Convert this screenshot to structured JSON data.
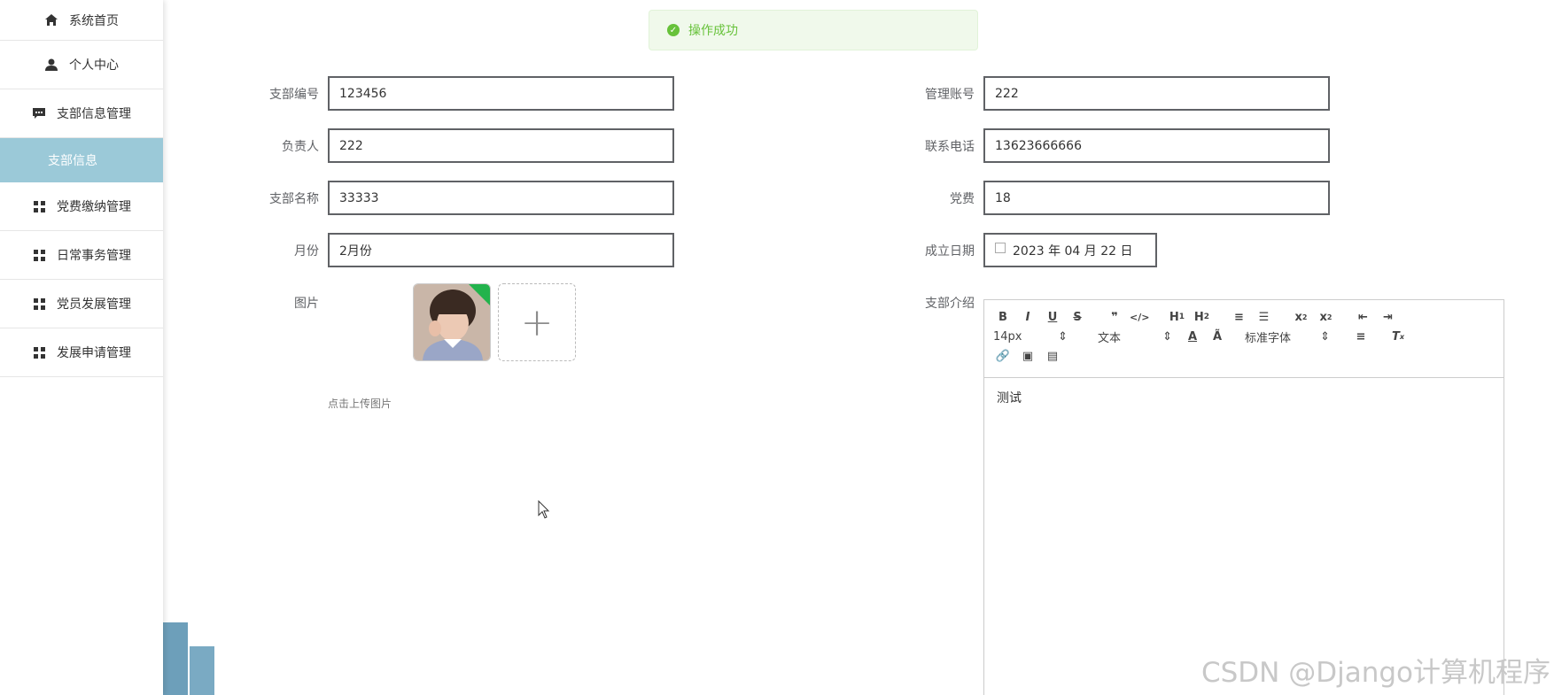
{
  "sidebar": {
    "items": [
      {
        "label": "系统首页",
        "icon": "home-icon"
      },
      {
        "label": "个人中心",
        "icon": "user-icon"
      },
      {
        "label": "支部信息管理",
        "icon": "message-icon"
      },
      {
        "label": "支部信息",
        "icon": "",
        "active": true
      },
      {
        "label": "党费缴纳管理",
        "icon": "grid-icon"
      },
      {
        "label": "日常事务管理",
        "icon": "grid-icon"
      },
      {
        "label": "党员发展管理",
        "icon": "grid-icon"
      },
      {
        "label": "发展申请管理",
        "icon": "grid-icon"
      }
    ]
  },
  "toast": {
    "message": "操作成功",
    "color": "#67c23a"
  },
  "form": {
    "branch_code": {
      "label": "支部编号",
      "value": "123456"
    },
    "admin_account": {
      "label": "管理账号",
      "value": "222"
    },
    "leader": {
      "label": "负责人",
      "value": "222"
    },
    "phone": {
      "label": "联系电话",
      "value": "13623666666"
    },
    "branch_name": {
      "label": "支部名称",
      "value": "33333"
    },
    "fee": {
      "label": "党费",
      "value": "18"
    },
    "month": {
      "label": "月份",
      "value": "2月份"
    },
    "founded": {
      "label": "成立日期",
      "value": "2023 年 04 月 22 日"
    },
    "image": {
      "label": "图片",
      "tip": "点击上传图片"
    },
    "intro": {
      "label": "支部介绍",
      "content": "测试"
    }
  },
  "editor": {
    "font_size": "14px",
    "paragraph": "文本",
    "font_family": "标准字体"
  },
  "watermark": "CSDN @Django计算机程序",
  "colors": {
    "active_menu": "#9bc9d8",
    "success": "#67c23a"
  }
}
